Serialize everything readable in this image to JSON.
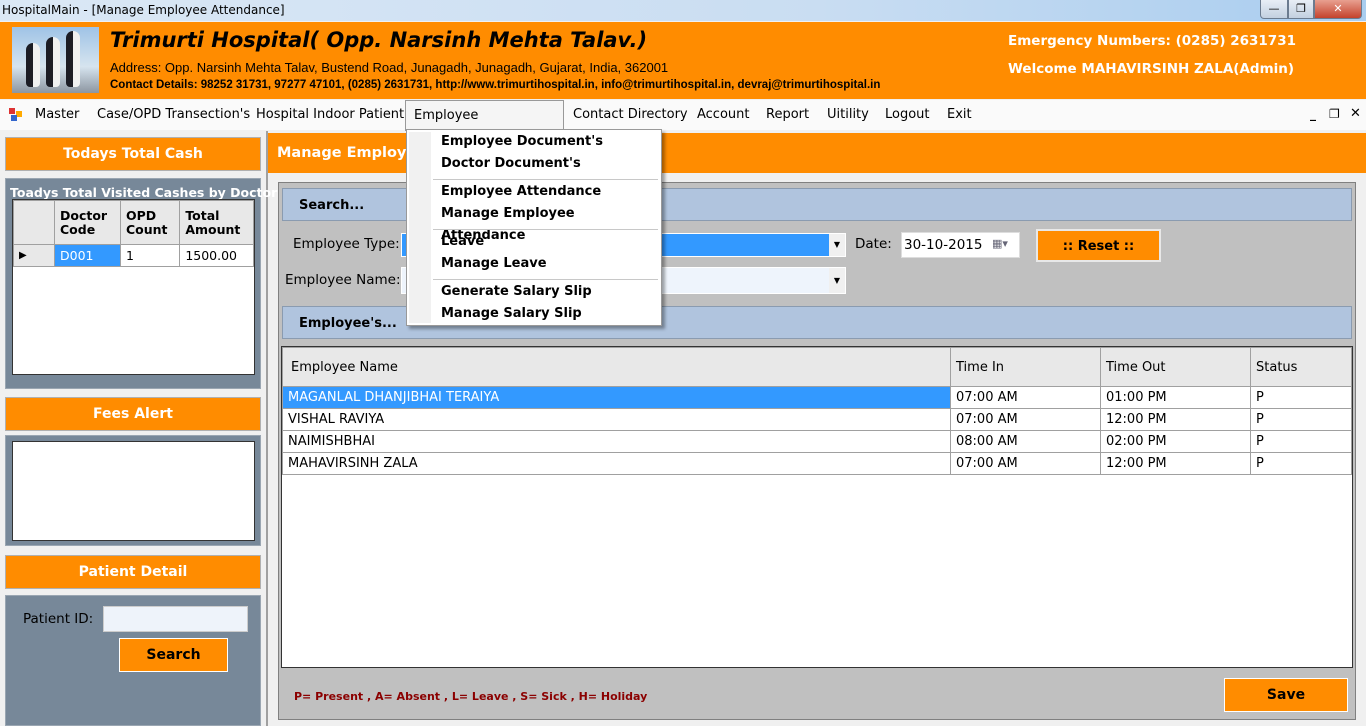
{
  "window": {
    "title": "HospitalMain - [Manage Employee Attendance]"
  },
  "header": {
    "hospital_name": "Trimurti Hospital( Opp. Narsinh Mehta Talav.)",
    "address": "Address: Opp. Narsinh Mehta Talav, Bustend Road, Junagadh, Junagadh, Gujarat, India, 362001",
    "contact": "Contact Details: 98252 31731, 97277 47101, (0285) 2631731, http://www.trimurtihospital.in, info@trimurtihospital.in, devraj@trimurtihospital.in",
    "emergency": "Emergency Numbers: (0285) 2631731",
    "welcome": "Welcome MAHAVIRSINH ZALA(Admin)"
  },
  "menu": {
    "items": [
      "Master",
      "Case/OPD Transection's",
      "Hospital Indoor Patient",
      "Employee Transection's",
      "Contact Directory",
      "Account",
      "Report",
      "Uitility",
      "Logout",
      "Exit"
    ]
  },
  "dropdown": {
    "items": [
      "Employee Document's",
      "Doctor Document's",
      "Employee Attendance",
      "Manage Employee Attendance",
      "Leave",
      "Manage Leave",
      "Generate Salary Slip",
      "Manage Salary Slip"
    ]
  },
  "sidebar": {
    "cash_button": "Todays Total Cash",
    "visited_label": "Toadys Total Visited Cashes by Doctors",
    "columns": [
      "Doctor Code",
      "OPD Count",
      "Total Amount"
    ],
    "rows": [
      [
        "D001",
        "1",
        "1500.00"
      ]
    ],
    "fees_alert": "Fees Alert",
    "patient_detail": "Patient Detail",
    "patient_id_label": "Patient ID:",
    "patient_id_value": "",
    "search_button": "Search"
  },
  "main": {
    "title": "Manage Employee's Attendance",
    "search_header": "Search...",
    "employee_type_label": "Employee Type:",
    "employee_type_value": "",
    "date_label": "Date:",
    "date_value": "30-10-2015",
    "reset_button": ":: Reset ::",
    "employee_name_label": "Employee Name:",
    "employee_name_value": "",
    "employees_header": "Employee's...",
    "columns": [
      "Employee Name",
      "Time In",
      "Time Out",
      "Status"
    ],
    "rows": [
      [
        "MAGANLAL DHANJIBHAI TERAIYA",
        "07:00 AM",
        "01:00 PM",
        "P"
      ],
      [
        "VISHAL RAVIYA",
        "07:00 AM",
        "12:00 PM",
        "P"
      ],
      [
        "NAIMISHBHAI",
        "08:00 AM",
        "02:00 PM",
        "P"
      ],
      [
        "MAHAVIRSINH ZALA",
        "07:00 AM",
        "12:00 PM",
        "P"
      ]
    ],
    "legend": "P= Present , A= Absent , L= Leave , S= Sick , H= Holiday",
    "save_button": "Save"
  },
  "colors": {
    "accent": "#ff8c00",
    "section": "#b0c4de",
    "selection": "#3399ff",
    "slate": "#778899"
  }
}
